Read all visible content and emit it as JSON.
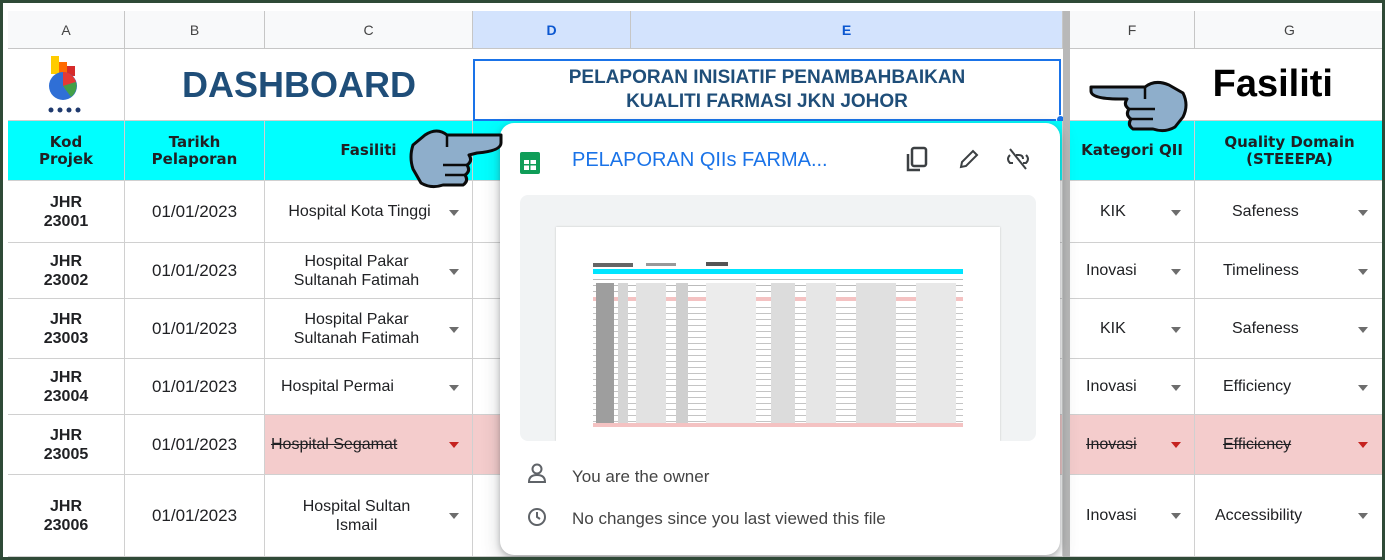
{
  "columns": [
    "A",
    "B",
    "C",
    "D",
    "E",
    "F",
    "G"
  ],
  "titles": {
    "dashboard": "DASHBOARD",
    "report_line1": "PELAPORAN INISIATIF PENAMBAHBAIKAN",
    "report_line2": "KUALITI FARMASI JKN JOHOR",
    "fasiliti": "Fasiliti"
  },
  "headers": {
    "kod": "Kod Projek",
    "tarikh": "Tarikh Pelaporan",
    "fasiliti": "Fasiliti",
    "kategori": "Kategori QII",
    "domain": "Quality Domain (STEEEPA)"
  },
  "rows": [
    {
      "kod": "JHR 23001",
      "tarikh": "01/01/2023",
      "fasiliti": "Hospital Kota Tinggi",
      "kategori": "KIK",
      "domain": "Safeness"
    },
    {
      "kod": "JHR 23002",
      "tarikh": "01/01/2023",
      "fasiliti": "Hospital Pakar Sultanah Fatimah",
      "kategori": "Inovasi",
      "domain": "Timeliness"
    },
    {
      "kod": "JHR 23003",
      "tarikh": "01/01/2023",
      "fasiliti": "Hospital Pakar Sultanah Fatimah",
      "kategori": "KIK",
      "domain": "Safeness"
    },
    {
      "kod": "JHR 23004",
      "tarikh": "01/01/2023",
      "fasiliti": "Hospital Permai",
      "kategori": "Inovasi",
      "domain": "Efficiency"
    },
    {
      "kod": "JHR 23005",
      "tarikh": "01/01/2023",
      "fasiliti": "Hospital Segamat",
      "kategori": "Inovasi",
      "domain": "Efficiency"
    },
    {
      "kod": "JHR 23006",
      "tarikh": "01/01/2023",
      "fasiliti": "Hospital Sultan Ismail",
      "kategori": "Inovasi",
      "domain": "Accessibility"
    }
  ],
  "popup": {
    "title": "PELAPORAN QIIs FARMA...",
    "owner": "You are the owner",
    "changes": "No changes since you last viewed this file"
  },
  "colors": {
    "header_cyan": "#00ffff",
    "dashboard_blue": "#1f4e79",
    "link_blue": "#1a73e8",
    "strike_row": "#f4cccc",
    "sheets_green": "#0f9d58"
  }
}
